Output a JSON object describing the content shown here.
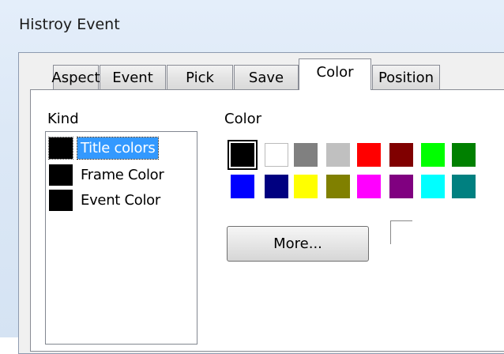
{
  "window": {
    "title": "Histroy Event"
  },
  "tabs": [
    {
      "label": "Aspect"
    },
    {
      "label": "Event"
    },
    {
      "label": "Pick"
    },
    {
      "label": "Save"
    },
    {
      "label": "Color",
      "active": true
    },
    {
      "label": "Position"
    }
  ],
  "kind": {
    "label": "Kind",
    "items": [
      {
        "label": "Title colors",
        "color": "#000000",
        "selected": true
      },
      {
        "label": "Frame Color",
        "color": "#000000"
      },
      {
        "label": "Event Color",
        "color": "#000000"
      }
    ]
  },
  "color": {
    "label": "Color",
    "swatches": [
      "#000000",
      "#ffffff",
      "#808080",
      "#c0c0c0",
      "#ff0000",
      "#800000",
      "#00ff00",
      "#008000",
      "#0000ff",
      "#000080",
      "#ffff00",
      "#808000",
      "#ff00ff",
      "#800080",
      "#00ffff",
      "#008080"
    ],
    "selected_swatch": "#000000",
    "more_button": "More..."
  }
}
